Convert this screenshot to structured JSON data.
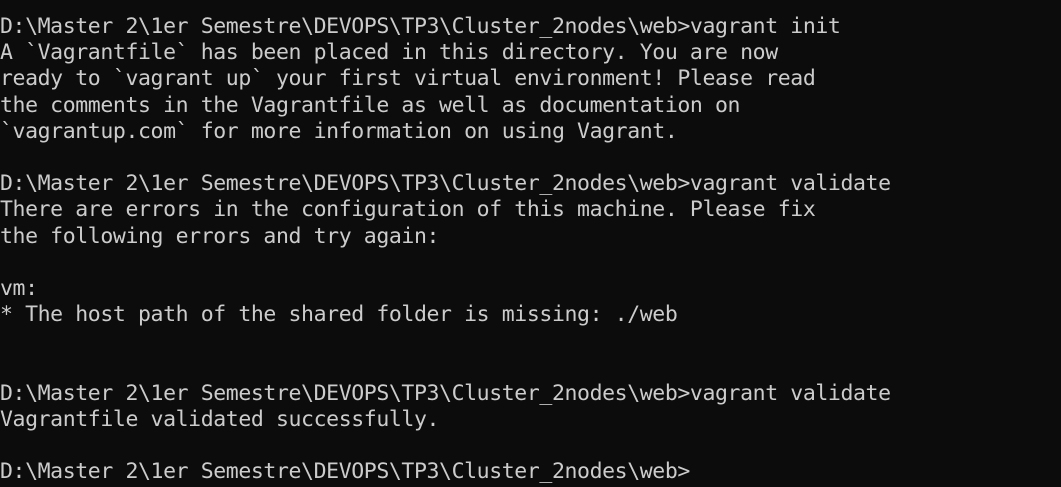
{
  "terminal": {
    "lines": [
      "D:\\Master 2\\1er Semestre\\DEVOPS\\TP3\\Cluster_2nodes\\web>vagrant init",
      "A `Vagrantfile` has been placed in this directory. You are now",
      "ready to `vagrant up` your first virtual environment! Please read",
      "the comments in the Vagrantfile as well as documentation on",
      "`vagrantup.com` for more information on using Vagrant.",
      "",
      "D:\\Master 2\\1er Semestre\\DEVOPS\\TP3\\Cluster_2nodes\\web>vagrant validate",
      "There are errors in the configuration of this machine. Please fix",
      "the following errors and try again:",
      "",
      "vm:",
      "* The host path of the shared folder is missing: ./web",
      "",
      "",
      "D:\\Master 2\\1er Semestre\\DEVOPS\\TP3\\Cluster_2nodes\\web>vagrant validate",
      "Vagrantfile validated successfully.",
      "",
      "D:\\Master 2\\1er Semestre\\DEVOPS\\TP3\\Cluster_2nodes\\web>"
    ],
    "colors": {
      "background": "#0c0c0c",
      "foreground": "#cccccc"
    }
  }
}
